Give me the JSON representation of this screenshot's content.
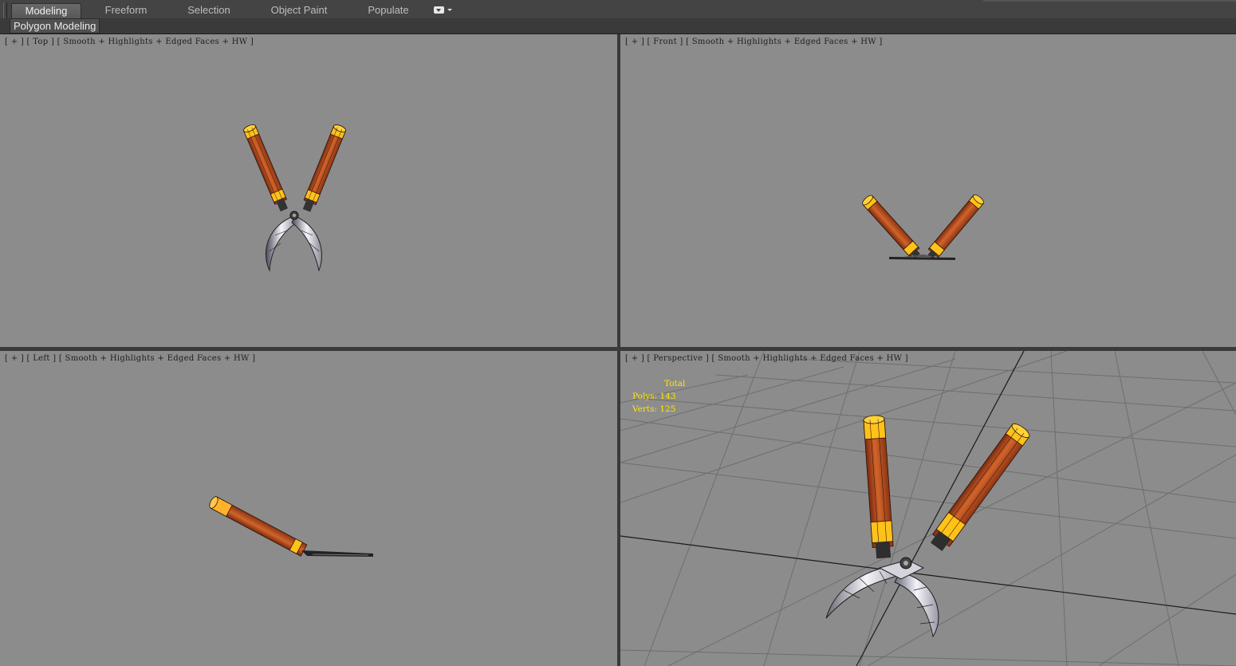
{
  "ribbon": {
    "tabs": [
      {
        "label": "Modeling",
        "active": true
      },
      {
        "label": "Freeform",
        "active": false
      },
      {
        "label": "Selection",
        "active": false
      },
      {
        "label": "Object Paint",
        "active": false
      },
      {
        "label": "Populate",
        "active": false
      }
    ],
    "dropdown_icon": "chevron-down-icon"
  },
  "panel": {
    "label": "Polygon Modeling"
  },
  "viewports": {
    "top": {
      "plus": "+",
      "view": "Top",
      "shading": "Smooth + Highlights + Edged Faces + HW"
    },
    "front": {
      "plus": "+",
      "view": "Front",
      "shading": "Smooth + Highlights + Edged Faces + HW"
    },
    "left": {
      "plus": "+",
      "view": "Left",
      "shading": "Smooth + Highlights + Edged Faces + HW"
    },
    "perspective": {
      "plus": "+",
      "view": "Perspective",
      "shading": "Smooth + Highlights + Edged Faces + HW",
      "stats": {
        "header": "Total",
        "polys_label": "Polys:",
        "polys": "143",
        "verts_label": "Verts:",
        "verts": "125"
      }
    }
  },
  "colors": {
    "viewport_bg": "#8c8c8c",
    "handle_wood": "#b8501e",
    "handle_cap": "#ffc21a",
    "blade": "#c8c8d2",
    "stats_text": "#ffe600"
  }
}
